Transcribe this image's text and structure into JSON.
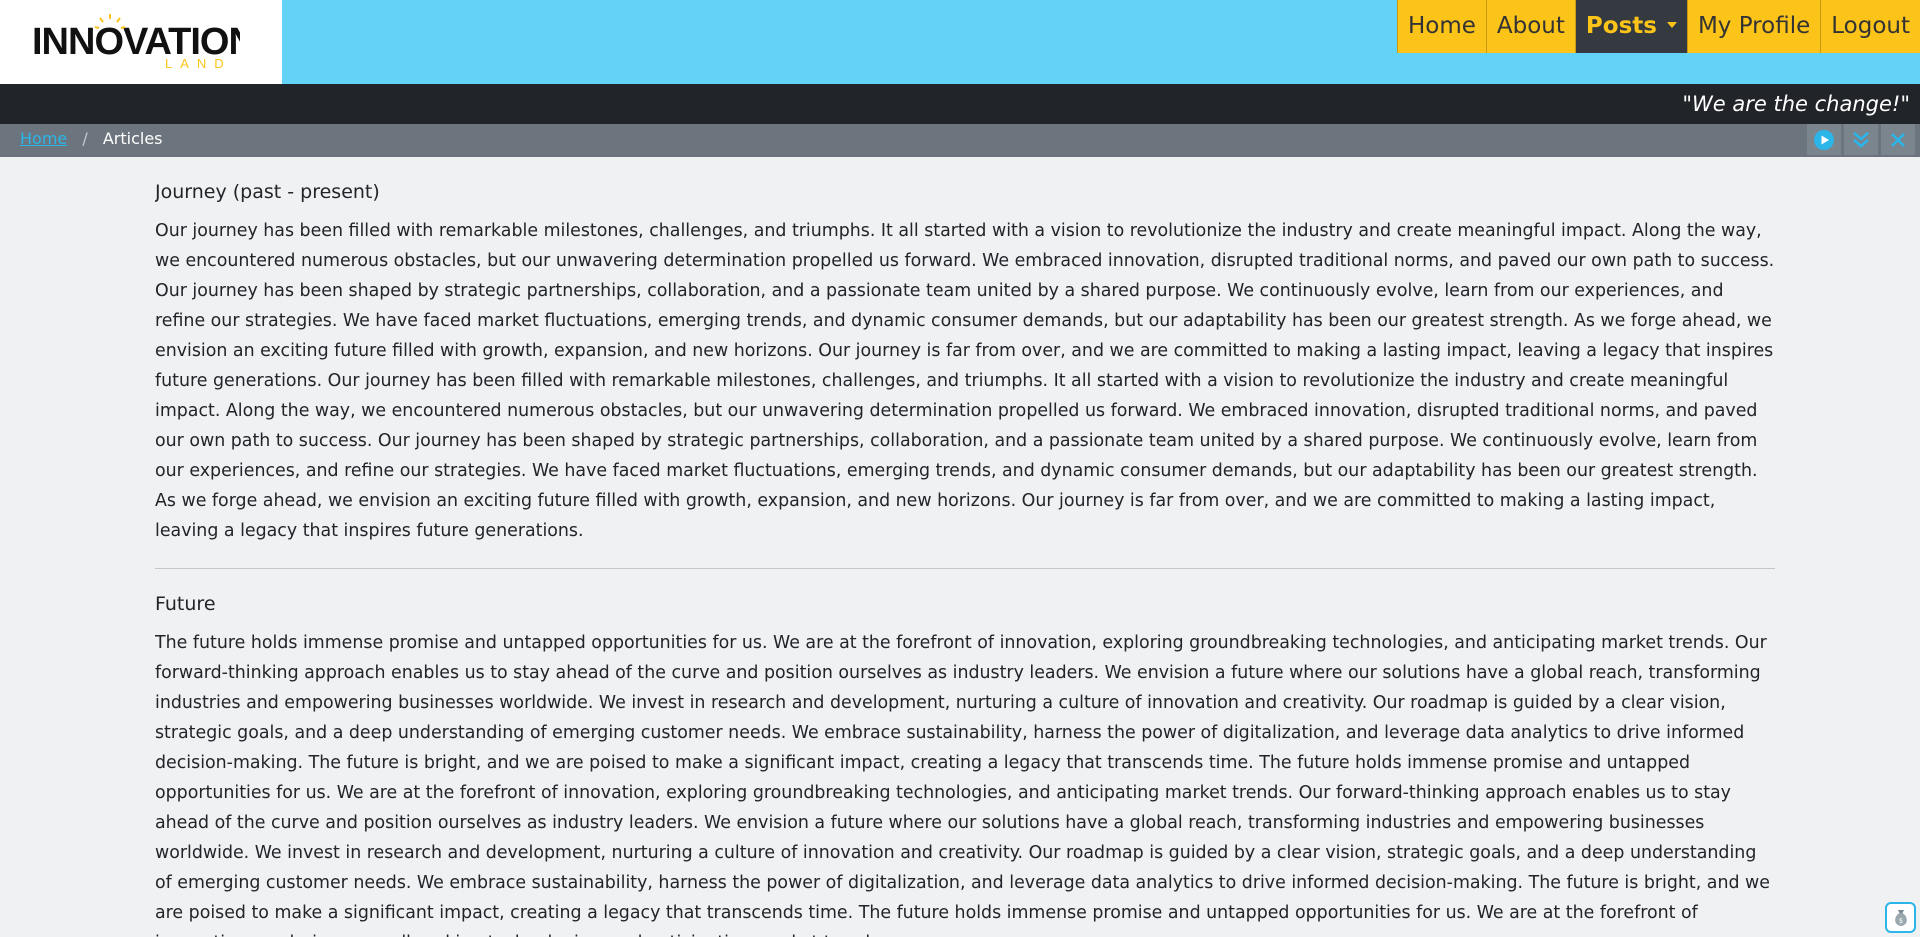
{
  "header": {
    "logo": {
      "line1": "INNOVATION",
      "line2": "LAND"
    },
    "nav": [
      {
        "label": "Home"
      },
      {
        "label": "About"
      },
      {
        "label": "Posts"
      },
      {
        "label": "My Profile"
      },
      {
        "label": "Logout"
      }
    ]
  },
  "tagline": "\"We are the change!\"",
  "breadcrumb": {
    "home": "Home",
    "separator": "/",
    "current": "Articles"
  },
  "toolbar": {
    "icons": [
      "play-icon",
      "chevrons-down-icon",
      "close-icon"
    ]
  },
  "sections": [
    {
      "title": "Journey (past - present)",
      "body": "Our journey has been filled with remarkable milestones, challenges, and triumphs. It all started with a vision to revolutionize the industry and create meaningful impact. Along the way, we encountered numerous obstacles, but our unwavering determination propelled us forward. We embraced innovation, disrupted traditional norms, and paved our own path to success. Our journey has been shaped by strategic partnerships, collaboration, and a passionate team united by a shared purpose. We continuously evolve, learn from our experiences, and refine our strategies. We have faced market fluctuations, emerging trends, and dynamic consumer demands, but our adaptability has been our greatest strength. As we forge ahead, we envision an exciting future filled with growth, expansion, and new horizons. Our journey is far from over, and we are committed to making a lasting impact, leaving a legacy that inspires future generations. Our journey has been filled with remarkable milestones, challenges, and triumphs. It all started with a vision to revolutionize the industry and create meaningful impact. Along the way, we encountered numerous obstacles, but our unwavering determination propelled us forward. We embraced innovation, disrupted traditional norms, and paved our own path to success. Our journey has been shaped by strategic partnerships, collaboration, and a passionate team united by a shared purpose. We continuously evolve, learn from our experiences, and refine our strategies. We have faced market fluctuations, emerging trends, and dynamic consumer demands, but our adaptability has been our greatest strength. As we forge ahead, we envision an exciting future filled with growth, expansion, and new horizons. Our journey is far from over, and we are committed to making a lasting impact, leaving a legacy that inspires future generations."
    },
    {
      "title": "Future",
      "body": "The future holds immense promise and untapped opportunities for us. We are at the forefront of innovation, exploring groundbreaking technologies, and anticipating market trends. Our forward-thinking approach enables us to stay ahead of the curve and position ourselves as industry leaders. We envision a future where our solutions have a global reach, transforming industries and empowering businesses worldwide. We invest in research and development, nurturing a culture of innovation and creativity. Our roadmap is guided by a clear vision, strategic goals, and a deep understanding of emerging customer needs. We embrace sustainability, harness the power of digitalization, and leverage data analytics to drive informed decision-making. The future is bright, and we are poised to make a significant impact, creating a legacy that transcends time. The future holds immense promise and untapped opportunities for us. We are at the forefront of innovation, exploring groundbreaking technologies, and anticipating market trends. Our forward-thinking approach enables us to stay ahead of the curve and position ourselves as industry leaders. We envision a future where our solutions have a global reach, transforming industries and empowering businesses worldwide. We invest in research and development, nurturing a culture of innovation and creativity. Our roadmap is guided by a clear vision, strategic goals, and a deep understanding of emerging customer needs. We embrace sustainability, harness the power of digitalization, and leverage data analytics to drive informed decision-making. The future is bright, and we are poised to make a significant impact, creating a legacy that transcends time. The future holds immense promise and untapped opportunities for us. We are at the forefront of innovation, exploring groundbreaking technologies, and anticipating market trends."
    }
  ],
  "colors": {
    "header_bg": "#63d2f7",
    "nav_bg": "#fcc419",
    "nav_active_bg": "#343a40",
    "tagline_bg": "#212529",
    "breadcrumb_bg": "#6c757d",
    "link": "#2bb5e8",
    "page_bg": "#eff1f3"
  }
}
